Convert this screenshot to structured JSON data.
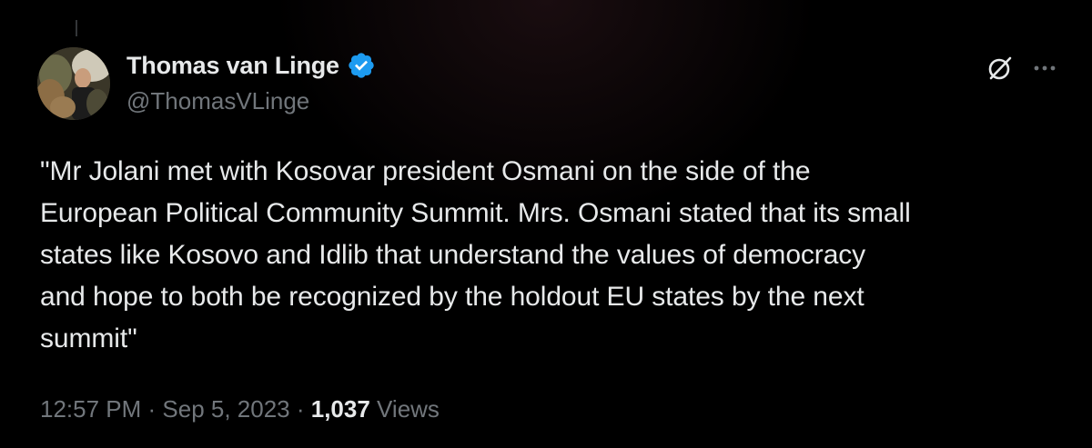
{
  "author": {
    "display_name": "Thomas van Linge",
    "handle": "@ThomasVLinge",
    "verified": true
  },
  "tweet": {
    "text": "\"Mr Jolani met with Kosovar president Osmani on the side of the\nEuropean Political Community Summit. Mrs. Osmani stated that its small\nstates like Kosovo and Idlib that understand the values of democracy\nand hope to both be recognized by the holdout EU states by the next\nsummit\""
  },
  "meta": {
    "time": "12:57 PM",
    "separator": " · ",
    "date": "Sep 5, 2023",
    "views_count": "1,037",
    "views_label": " Views"
  },
  "icons": {
    "verified": "verified-badge-icon",
    "grok": "grok-icon",
    "more": "more-icon"
  },
  "colors": {
    "background": "#000000",
    "text_primary": "#e7e9ea",
    "text_secondary": "#71767b",
    "verified_blue": "#1d9bf0"
  }
}
